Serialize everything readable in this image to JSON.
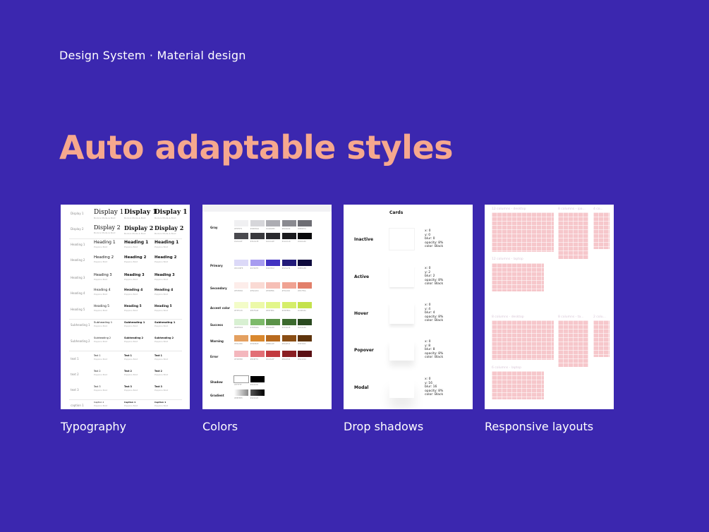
{
  "header": {
    "eyebrow": "Design System · Material design",
    "headline": "Auto adaptable styles"
  },
  "colors": {
    "background": "#3B27AF",
    "headline": "#F6A88E",
    "caption": "#FFFFFF"
  },
  "cards": [
    {
      "caption": "Typography"
    },
    {
      "caption": "Colors"
    },
    {
      "caption": "Drop shadows"
    },
    {
      "caption": "Responsive layouts"
    }
  ],
  "typography_card": {
    "rows": [
      {
        "label": "Display 1",
        "sample": "Display 1",
        "sub": "Bodoni Moda & Bold"
      },
      {
        "label": "Display 2",
        "sample": "Display 2",
        "sub": "Bodoni Moda & Bold"
      },
      {
        "label": "Heading 1",
        "sample": "Heading 1",
        "sub": "Poppins Bold"
      },
      {
        "label": "Heading 2",
        "sample": "Heading 2",
        "sub": "Poppins Bold"
      },
      {
        "label": "Heading 3",
        "sample": "Heading 3",
        "sub": "Poppins Bold"
      },
      {
        "label": "Heading 4",
        "sample": "Heading 4",
        "sub": "Poppins Bold"
      },
      {
        "label": "Heading 5",
        "sample": "Heading 5",
        "sub": "Poppins Bold"
      },
      {
        "label": "Subheading 1",
        "sample": "Subheading 1",
        "sub": "Poppins Bold"
      },
      {
        "label": "Subheading 2",
        "sample": "Subheading 2",
        "sub": "Poppins Bold"
      },
      {
        "label": "text 1",
        "sample": "Text 1",
        "sub": "Poppins Bold"
      },
      {
        "label": "text 2",
        "sample": "Text 2",
        "sub": "Poppins Bold"
      },
      {
        "label": "text 3",
        "sample": "Text 3",
        "sub": "Poppins Bold"
      },
      {
        "label": "caption 1",
        "sample": "Caption 1",
        "sub": "Poppins Bold"
      }
    ]
  },
  "colors_card": {
    "groups": [
      {
        "name": "Gray",
        "swatches": [
          "#F0F0F2",
          "#D6D6DA",
          "#ADADB3",
          "#8A8A90",
          "#6E6E74",
          "#4A4A4F",
          "#3A3A3E",
          "#2A2A2E",
          "#1A1A1D",
          "#0A0A0C"
        ]
      },
      {
        "name": "Primary",
        "swatches": [
          "#DCD9F8",
          "#A79CF0",
          "#4233C2",
          "#221A79",
          "#0E0A3D"
        ]
      },
      {
        "name": "Secondary",
        "swatches": [
          "#FDEDEA",
          "#FADAD4",
          "#F6BFB6",
          "#F0A292",
          "#E27F6A"
        ]
      },
      {
        "name": "Accent color",
        "swatches": [
          "#F3FCC8",
          "#ECF9A8",
          "#E2F68A",
          "#D5EE6A",
          "#C4E24C"
        ]
      },
      {
        "name": "Success",
        "swatches": [
          "#D8F0D2",
          "#7DBA6A",
          "#5A9248",
          "#3C6A2E",
          "#2A4A20"
        ]
      },
      {
        "name": "Warning",
        "swatches": [
          "#E4A060",
          "#D9882E",
          "#B86A1E",
          "#8A4E14",
          "#5E340C"
        ]
      },
      {
        "name": "Error",
        "swatches": [
          "#F4B7BD",
          "#E26F76",
          "#C23A3F",
          "#8A1E22",
          "#5A1014"
        ]
      },
      {
        "name": "Shadow",
        "swatches": [
          "#FFFFFF",
          "#000000"
        ]
      },
      {
        "name": "Gradient",
        "swatches": [
          "#E8E8E8",
          "#222222"
        ]
      }
    ]
  },
  "shadows_card": {
    "title": "Cards",
    "states": [
      {
        "name": "Inactive",
        "spec": "x: 0\ny: 0\nblur: 0\nopacity: 8%\ncolor: Black"
      },
      {
        "name": "Active",
        "spec": "x: 0\ny: 2\nblur: 2\nopacity: 8%\ncolor: Black"
      },
      {
        "name": "Hover",
        "spec": "x: 0\ny: 4\nblur: 4\nopacity: 8%\ncolor: Black"
      },
      {
        "name": "Popover",
        "spec": "x: 0\ny: 8\nblur: 8\nopacity: 8%\ncolor: Black"
      },
      {
        "name": "Modal",
        "spec": "x: 0\ny: 16\nblur: 16\nopacity: 8%\ncolor: Black"
      }
    ]
  },
  "layouts_card": {
    "labels": [
      "12 columns - desktop",
      "8 columns - ipa...",
      "4 co...",
      "12 columns - laptop",
      "8 columns - desktop",
      "8 columns - ta...",
      "2 colu...",
      "6 columns - laptop"
    ]
  }
}
